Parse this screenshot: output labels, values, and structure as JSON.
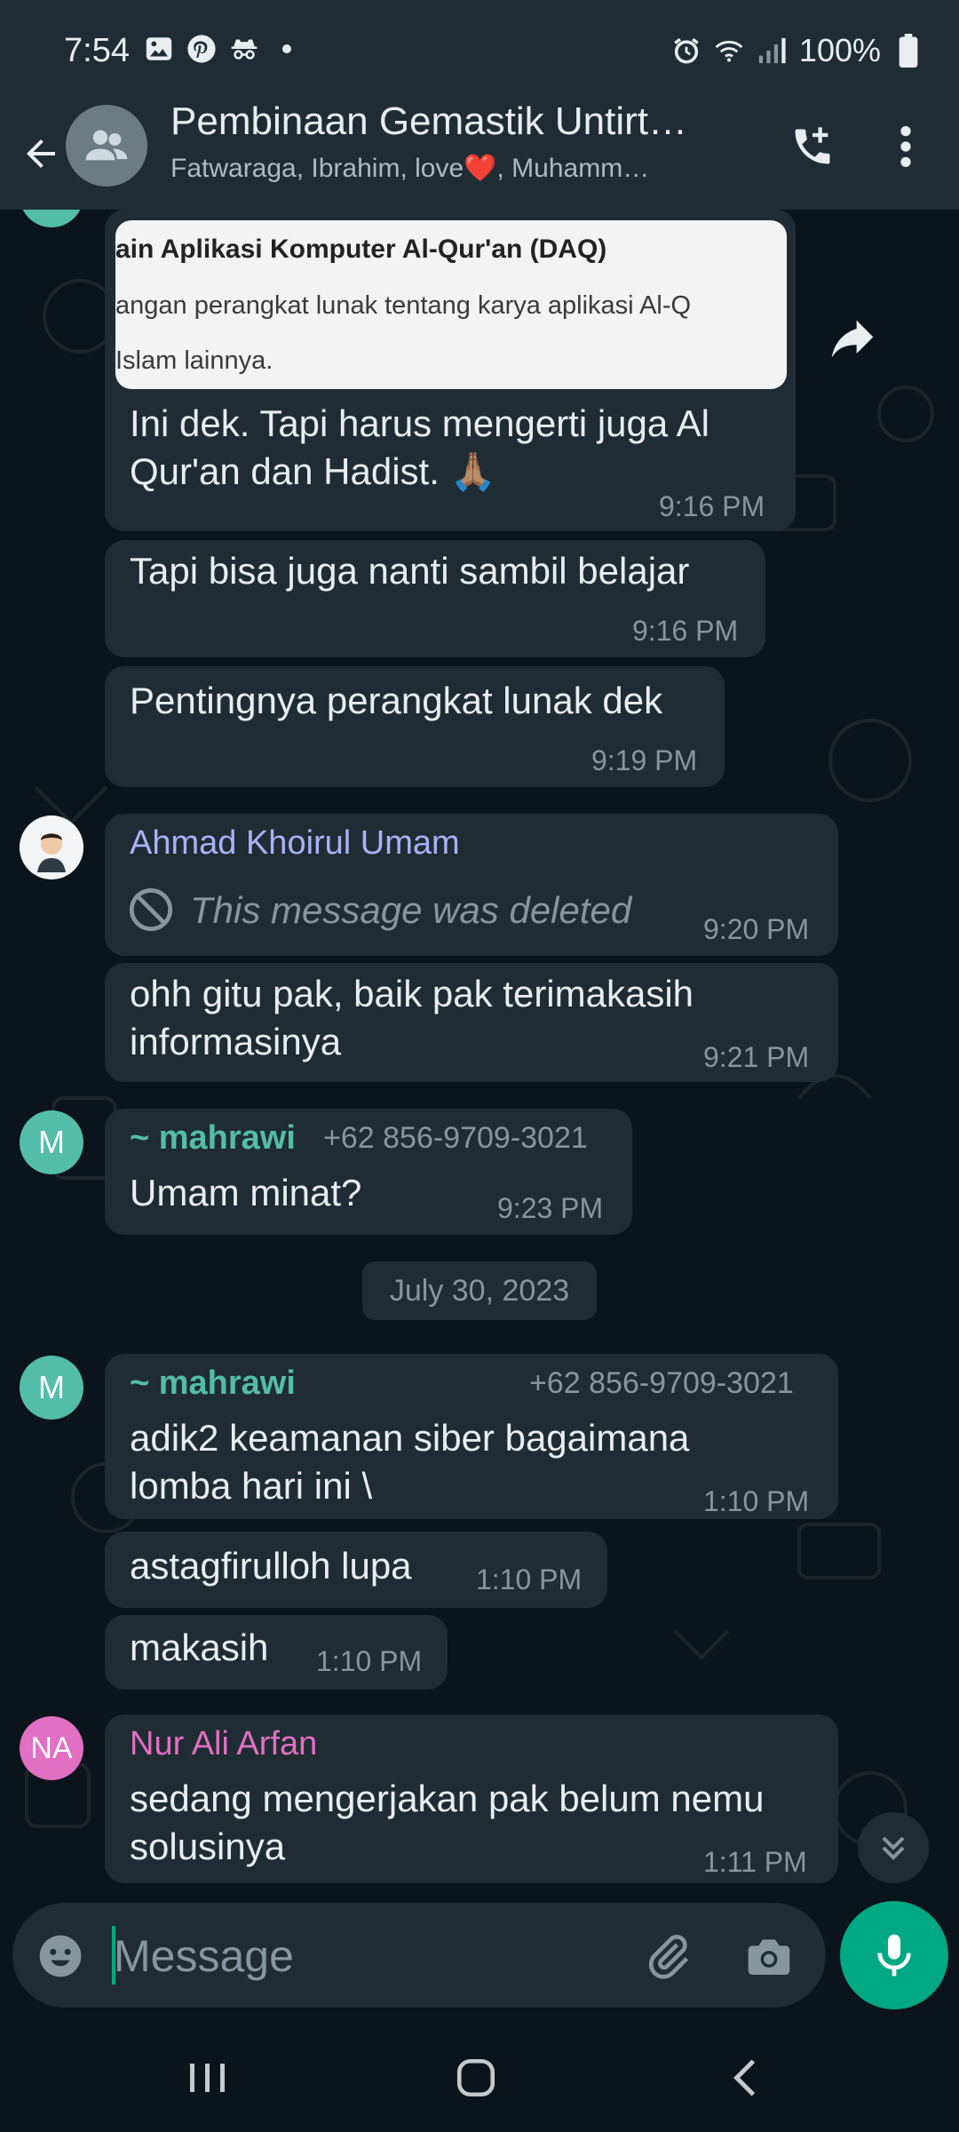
{
  "status_bar": {
    "time": "7:54",
    "battery": "100%"
  },
  "header": {
    "title": "Pembinaan Gemastik Untirt…",
    "subtitle": "Fatwaraga, Ibrahim, love❤️, Muhamm…"
  },
  "shared_image": {
    "line1": "ain Aplikasi Komputer Al-Qur'an (DAQ)",
    "line2": "angan perangkat lunak tentang karya aplikasi Al-Q",
    "line3": "Islam lainnya."
  },
  "messages": [
    {
      "text": "Ini dek. Tapi harus mengerti juga Al Qur'an dan Hadist. 🙏🏽",
      "time": "9:16 PM"
    },
    {
      "text": "Tapi bisa juga nanti sambil belajar",
      "time": "9:16 PM"
    },
    {
      "text": "Pentingnya perangkat lunak dek",
      "time": "9:19 PM"
    },
    {
      "sender": "Ahmad Khoirul Umam",
      "text": "This message was deleted",
      "time": "9:20 PM"
    },
    {
      "text": "ohh gitu pak, baik pak terimakasih informasinya",
      "time": "9:21 PM"
    },
    {
      "sender": "~ mahrawi",
      "phone": "+62 856-9709-3021",
      "text": "Umam minat?",
      "time": "9:23 PM",
      "avatar": "M"
    },
    {
      "sender": "~ mahrawi",
      "phone": "+62 856-9709-3021",
      "text": "adik2 keamanan siber bagaimana lomba hari ini \\",
      "time": "1:10 PM",
      "avatar": "M"
    },
    {
      "text": "astagfirulloh lupa",
      "time": "1:10 PM"
    },
    {
      "text": "makasih",
      "time": "1:10 PM"
    },
    {
      "sender": "Nur Ali Arfan",
      "text": "sedang mengerjakan pak belum nemu solusinya",
      "time": "1:11 PM",
      "avatar": "NA"
    }
  ],
  "date_separator": "July 30, 2023",
  "input": {
    "placeholder": "Message"
  },
  "colors": {
    "mahrawi": "#53bdaa",
    "umam": "#a5b4f5",
    "nur_ali": "#e16fc3",
    "accent": "#00a884"
  }
}
